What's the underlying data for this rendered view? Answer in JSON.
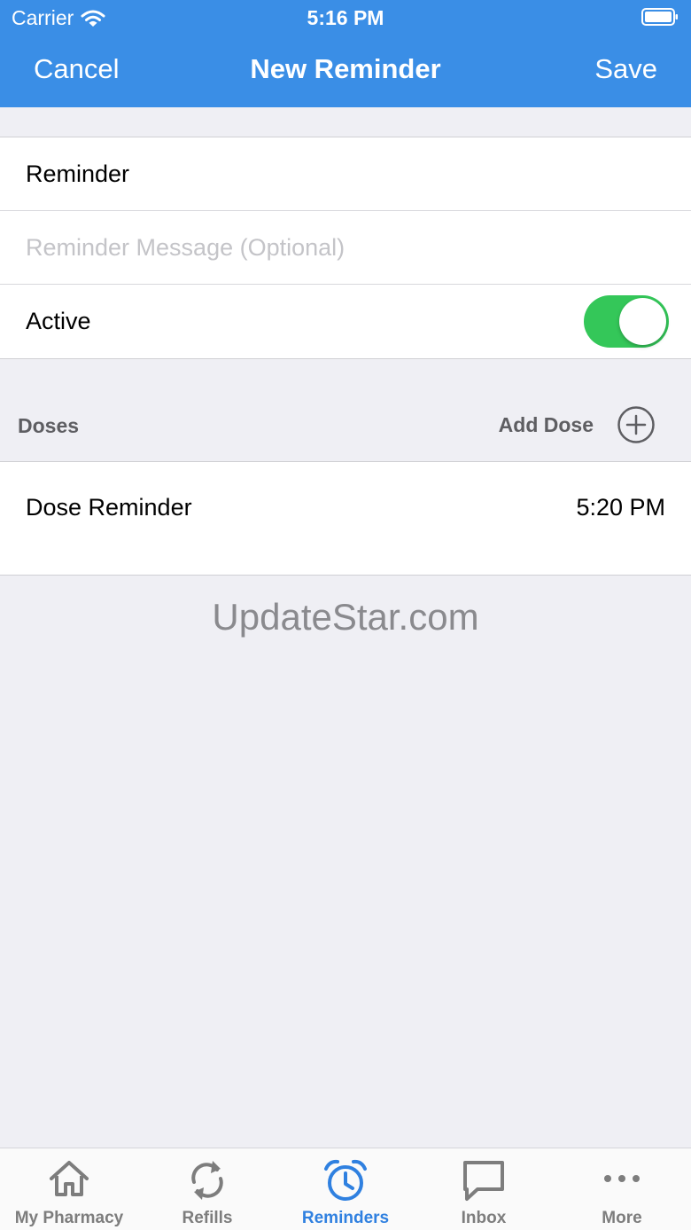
{
  "status_bar": {
    "carrier": "Carrier",
    "time": "5:16 PM"
  },
  "nav": {
    "cancel_label": "Cancel",
    "title": "New Reminder",
    "save_label": "Save"
  },
  "form": {
    "reminder_name": "Reminder",
    "message_placeholder": "Reminder Message (Optional)",
    "active_label": "Active",
    "active": true
  },
  "doses_section": {
    "title": "Doses",
    "add_label": "Add Dose"
  },
  "doses": [
    {
      "label": "Dose Reminder",
      "time": "5:20 PM"
    }
  ],
  "watermark": "UpdateStar.com",
  "tabbar": {
    "active_tab": "Reminders",
    "accent_color": "#2f80e0",
    "tabs": [
      {
        "label": "My Pharmacy",
        "icon": "home-icon"
      },
      {
        "label": "Refills",
        "icon": "refresh-icon"
      },
      {
        "label": "Reminders",
        "icon": "alarm-clock-icon"
      },
      {
        "label": "Inbox",
        "icon": "chat-bubble-icon"
      },
      {
        "label": "More",
        "icon": "more-dots-icon"
      }
    ]
  },
  "colors": {
    "header": "#3a8ee6",
    "toggle_on": "#34c759",
    "background": "#efeff4"
  }
}
